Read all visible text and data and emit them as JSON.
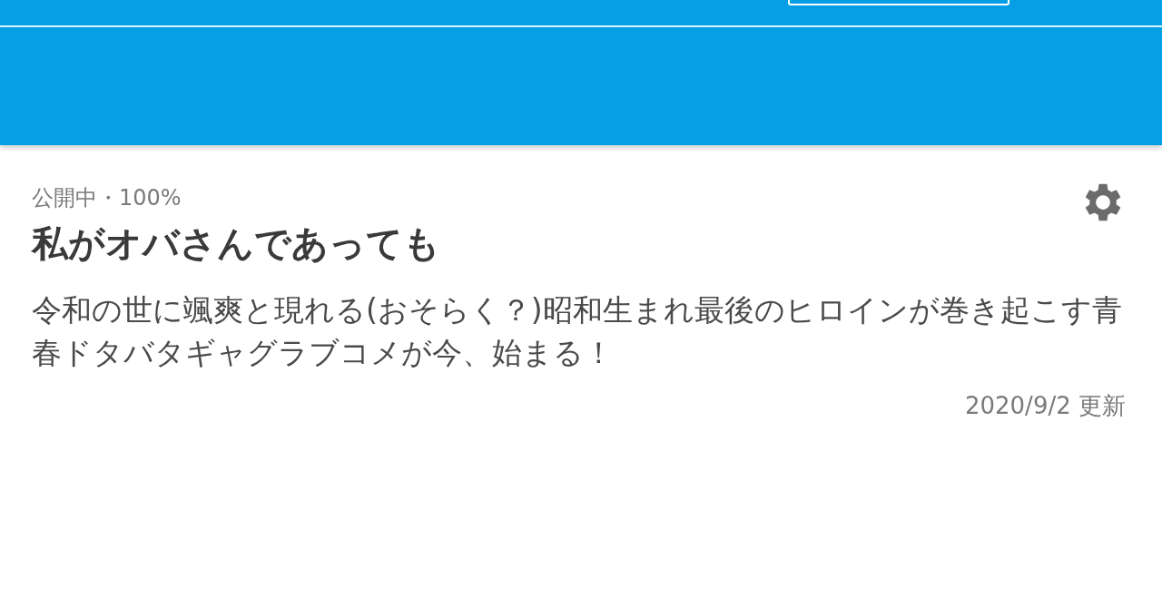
{
  "work": {
    "status": "公開中・100%",
    "title": "私がオバさんであっても",
    "description": "令和の世に颯爽と現れる(おそらく？)昭和生まれ最後のヒロインが巻き起こす青春ドタバタギャグラブコメが今、始まる！",
    "updated": "2020/9/2 更新"
  }
}
